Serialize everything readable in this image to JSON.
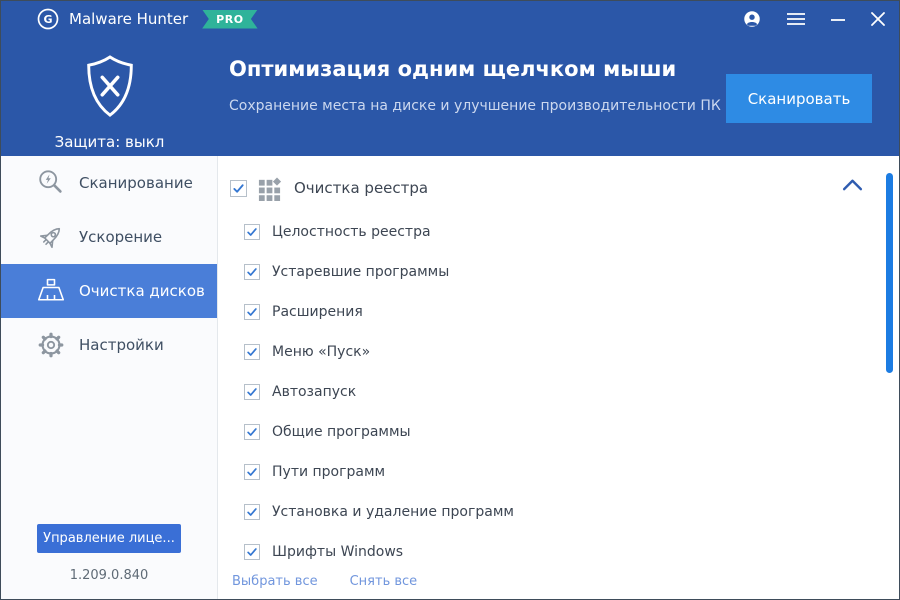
{
  "titlebar": {
    "app_name": "Malware Hunter",
    "badge": "PRO",
    "icons": [
      "account-icon",
      "menu-icon",
      "minimize-icon",
      "close-icon"
    ]
  },
  "header": {
    "protection_status": "Защита: выкл",
    "title": "Оптимизация одним щелчком мыши",
    "subtitle": "Сохранение места на диске и улучшение производительности ПК",
    "scan_button": "Сканировать"
  },
  "sidebar": {
    "items": [
      {
        "id": "scan",
        "label": "Сканирование",
        "icon": "scan-magnifier-icon",
        "selected": false
      },
      {
        "id": "speedup",
        "label": "Ускорение",
        "icon": "rocket-icon",
        "selected": false
      },
      {
        "id": "cleanup",
        "label": "Очистка дисков",
        "icon": "broom-icon",
        "selected": true
      },
      {
        "id": "settings",
        "label": "Настройки",
        "icon": "gear-icon",
        "selected": false
      }
    ],
    "license_button": "Управление лице...",
    "version": "1.209.0.840"
  },
  "content": {
    "group": {
      "label": "Очистка реестра",
      "checked": true,
      "icon": "registry-grid-icon",
      "collapse_icon": "chevron-up-icon"
    },
    "items": [
      {
        "label": "Целостность реестра",
        "checked": true
      },
      {
        "label": "Устаревшие программы",
        "checked": true
      },
      {
        "label": "Расширения",
        "checked": true
      },
      {
        "label": "Меню «Пуск»",
        "checked": true
      },
      {
        "label": "Автозапуск",
        "checked": true
      },
      {
        "label": "Общие программы",
        "checked": true
      },
      {
        "label": "Пути программ",
        "checked": true
      },
      {
        "label": "Установка и удаление программ",
        "checked": true
      },
      {
        "label": "Шрифты Windows",
        "checked": true
      }
    ],
    "select_all": "Выбрать все",
    "deselect_all": "Снять все"
  },
  "colors": {
    "titlebar_bg": "#2b57a8",
    "header_bg": "#2b57a8",
    "sidebar_selected_bg": "#4a7ed8",
    "scan_button_bg": "#2e8be4",
    "license_button_bg": "#3a6fd6",
    "badge_bg": "#2fb39a",
    "link_color": "#7196dd",
    "checkbox_check": "#3477d2",
    "scrollbar_thumb": "#1c7ce2",
    "text_dark": "#3d4653"
  }
}
